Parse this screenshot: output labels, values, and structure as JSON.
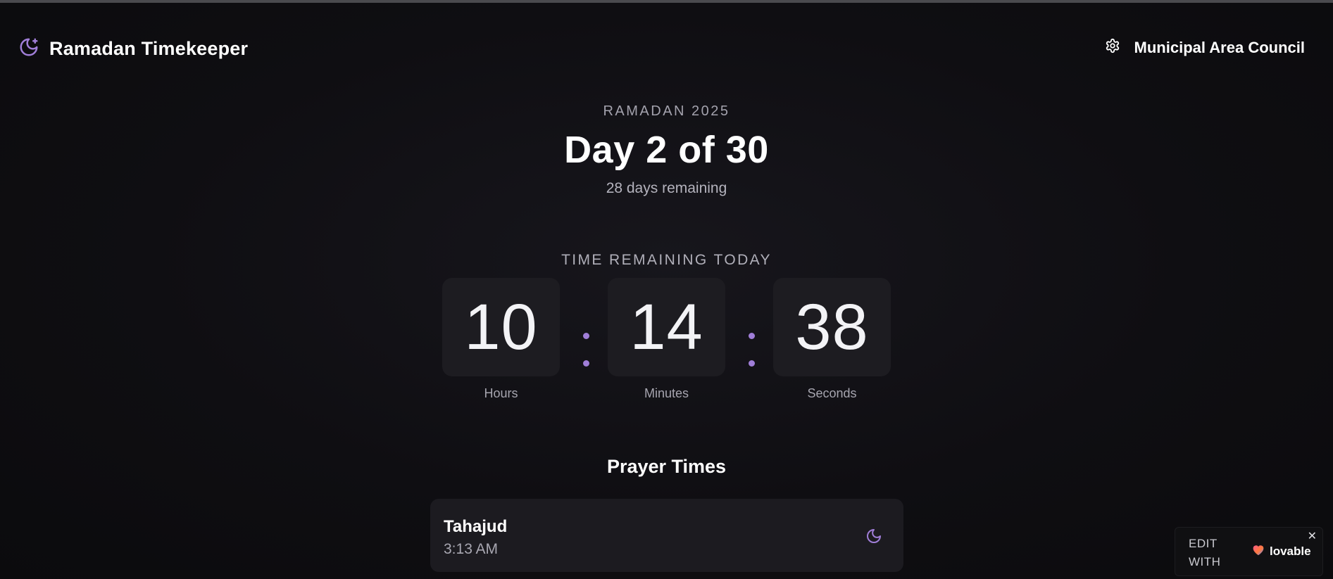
{
  "header": {
    "app_title": "Ramadan Timekeeper",
    "brand_icon": "moon-star-icon",
    "location_label": "Municipal Area Council",
    "settings_icon": "gear-icon"
  },
  "ramadan": {
    "eyebrow": "RAMADAN 2025",
    "day_title": "Day 2 of 30",
    "days_remaining": "28 days remaining"
  },
  "countdown": {
    "label": "TIME REMAINING TODAY",
    "hours": "10",
    "minutes": "14",
    "seconds": "38",
    "hours_label": "Hours",
    "minutes_label": "Minutes",
    "seconds_label": "Seconds"
  },
  "prayer_times": {
    "heading": "Prayer Times",
    "items": [
      {
        "name": "Tahajud",
        "time": "3:13 AM",
        "icon": "moon-icon"
      }
    ]
  },
  "badge": {
    "edit_text": "EDIT WITH",
    "logo_text": "lovable",
    "close_glyph": "✕"
  },
  "colors": {
    "accent": "#a07ed8",
    "background": "#0f0e12",
    "card": "#1d1c21"
  }
}
